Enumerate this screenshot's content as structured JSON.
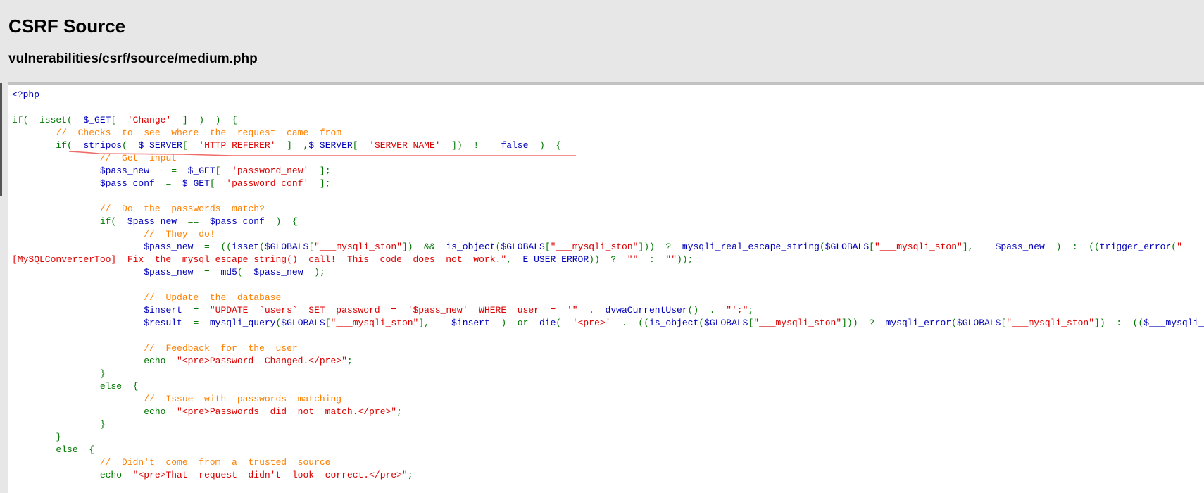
{
  "page": {
    "title": "CSRF Source",
    "file_path": "vulnerabilities/csrf/source/medium.php"
  },
  "colors": {
    "keyword": "#007700",
    "default": "#0000BB",
    "string": "#DD0000",
    "comment": "#FF8000",
    "annotation": "#f06a6a"
  },
  "code_lines": [
    [
      [
        "d",
        "<?php"
      ]
    ],
    [],
    [
      [
        "k",
        "if(  isset(  "
      ],
      [
        "d",
        "$_GET"
      ],
      [
        "k",
        "[  "
      ],
      [
        "s",
        "'Change'"
      ],
      [
        "k",
        "  ]  )  )  {"
      ]
    ],
    [
      [
        "c",
        "\t//  Checks  to  see  where  the  request  came  from"
      ]
    ],
    [
      [
        "k",
        "\tif(  "
      ],
      [
        "d",
        "stripos"
      ],
      [
        "k",
        "(  "
      ],
      [
        "d",
        "$_SERVER"
      ],
      [
        "k",
        "[  "
      ],
      [
        "s",
        "'HTTP_REFERER'"
      ],
      [
        "k",
        "  ]  ,"
      ],
      [
        "d",
        "$_SERVER"
      ],
      [
        "k",
        "[  "
      ],
      [
        "s",
        "'SERVER_NAME'"
      ],
      [
        "k",
        "  ])  !==  "
      ],
      [
        "d",
        "false"
      ],
      [
        "k",
        "  )  {"
      ]
    ],
    [
      [
        "c",
        "\t\t//  Get  input"
      ]
    ],
    [
      [
        "d",
        "\t\t$pass_new"
      ],
      [
        "k",
        "    =  "
      ],
      [
        "d",
        "$_GET"
      ],
      [
        "k",
        "[  "
      ],
      [
        "s",
        "'password_new'"
      ],
      [
        "k",
        "  ];"
      ]
    ],
    [
      [
        "d",
        "\t\t$pass_conf"
      ],
      [
        "k",
        "  =  "
      ],
      [
        "d",
        "$_GET"
      ],
      [
        "k",
        "[  "
      ],
      [
        "s",
        "'password_conf'"
      ],
      [
        "k",
        "  ];"
      ]
    ],
    [],
    [
      [
        "c",
        "\t\t//  Do  the  passwords  match?"
      ]
    ],
    [
      [
        "k",
        "\t\tif(  "
      ],
      [
        "d",
        "$pass_new"
      ],
      [
        "k",
        "  ==  "
      ],
      [
        "d",
        "$pass_conf"
      ],
      [
        "k",
        "  )  {"
      ]
    ],
    [
      [
        "c",
        "\t\t\t//  They  do!"
      ]
    ],
    [
      [
        "d",
        "\t\t\t$pass_new"
      ],
      [
        "k",
        "  =  (("
      ],
      [
        "d",
        "isset"
      ],
      [
        "k",
        "("
      ],
      [
        "d",
        "$GLOBALS"
      ],
      [
        "k",
        "["
      ],
      [
        "s",
        "\"___mysqli_ston\""
      ],
      [
        "k",
        "])  &&  "
      ],
      [
        "d",
        "is_object"
      ],
      [
        "k",
        "("
      ],
      [
        "d",
        "$GLOBALS"
      ],
      [
        "k",
        "["
      ],
      [
        "s",
        "\"___mysqli_ston\""
      ],
      [
        "k",
        "]))  ?  "
      ],
      [
        "d",
        "mysqli_real_escape_string"
      ],
      [
        "k",
        "("
      ],
      [
        "d",
        "$GLOBALS"
      ],
      [
        "k",
        "["
      ],
      [
        "s",
        "\"___mysqli_ston\""
      ],
      [
        "k",
        "],    "
      ],
      [
        "d",
        "$pass_new"
      ],
      [
        "k",
        "  )  :  (("
      ],
      [
        "d",
        "trigger_error"
      ],
      [
        "k",
        "("
      ],
      [
        "s",
        "\""
      ]
    ],
    [
      [
        "s",
        "[MySQLConverterToo]  Fix  the  mysql_escape_string()  call!  This  code  does  not  work.\""
      ],
      [
        "k",
        ",  "
      ],
      [
        "d",
        "E_USER_ERROR"
      ],
      [
        "k",
        "))  ?  "
      ],
      [
        "s",
        "\"\""
      ],
      [
        "k",
        "  :  "
      ],
      [
        "s",
        "\"\""
      ],
      [
        "k",
        "));"
      ]
    ],
    [
      [
        "d",
        "\t\t\t$pass_new"
      ],
      [
        "k",
        "  =  "
      ],
      [
        "d",
        "md5"
      ],
      [
        "k",
        "(  "
      ],
      [
        "d",
        "$pass_new"
      ],
      [
        "k",
        "  );"
      ]
    ],
    [],
    [
      [
        "c",
        "\t\t\t//  Update  the  database"
      ]
    ],
    [
      [
        "d",
        "\t\t\t$insert"
      ],
      [
        "k",
        "  =  "
      ],
      [
        "s",
        "\"UPDATE  `users`  SET  password  =  '$pass_new'  WHERE  user  =  '\""
      ],
      [
        "k",
        "  .  "
      ],
      [
        "d",
        "dvwaCurrentUser"
      ],
      [
        "k",
        "()  .  "
      ],
      [
        "s",
        "\"';\""
      ],
      [
        "k",
        ";"
      ]
    ],
    [
      [
        "d",
        "\t\t\t$result"
      ],
      [
        "k",
        "  =  "
      ],
      [
        "d",
        "mysqli_query"
      ],
      [
        "k",
        "("
      ],
      [
        "d",
        "$GLOBALS"
      ],
      [
        "k",
        "["
      ],
      [
        "s",
        "\"___mysqli_ston\""
      ],
      [
        "k",
        "],    "
      ],
      [
        "d",
        "$insert"
      ],
      [
        "k",
        "  )  or  "
      ],
      [
        "d",
        "die"
      ],
      [
        "k",
        "(  "
      ],
      [
        "s",
        "'<pre>'"
      ],
      [
        "k",
        "  .  (("
      ],
      [
        "d",
        "is_object"
      ],
      [
        "k",
        "("
      ],
      [
        "d",
        "$GLOBALS"
      ],
      [
        "k",
        "["
      ],
      [
        "s",
        "\"___mysqli_ston\""
      ],
      [
        "k",
        "]))  ?  "
      ],
      [
        "d",
        "mysqli_error"
      ],
      [
        "k",
        "("
      ],
      [
        "d",
        "$GLOBALS"
      ],
      [
        "k",
        "["
      ],
      [
        "s",
        "\"___mysqli_ston\""
      ],
      [
        "k",
        "])  :  (("
      ],
      [
        "d",
        "$___mysqli_res"
      ]
    ],
    [],
    [
      [
        "c",
        "\t\t\t//  Feedback  for  the  user"
      ]
    ],
    [
      [
        "k",
        "\t\t\techo  "
      ],
      [
        "s",
        "\"<pre>Password  Changed.</pre>\""
      ],
      [
        "k",
        ";"
      ]
    ],
    [
      [
        "k",
        "\t\t}"
      ]
    ],
    [
      [
        "k",
        "\t\telse  {"
      ]
    ],
    [
      [
        "c",
        "\t\t\t//  Issue  with  passwords  matching"
      ]
    ],
    [
      [
        "k",
        "\t\t\techo  "
      ],
      [
        "s",
        "\"<pre>Passwords  did  not  match.</pre>\""
      ],
      [
        "k",
        ";"
      ]
    ],
    [
      [
        "k",
        "\t\t}"
      ]
    ],
    [
      [
        "k",
        "\t}"
      ]
    ],
    [
      [
        "k",
        "\telse  {"
      ]
    ],
    [
      [
        "c",
        "\t\t//  Didn't  come  from  a  trusted  source"
      ]
    ],
    [
      [
        "k",
        "\t\techo  "
      ],
      [
        "s",
        "\"<pre>That  request  didn't  look  correct.</pre>\""
      ],
      [
        "k",
        ";"
      ]
    ]
  ]
}
